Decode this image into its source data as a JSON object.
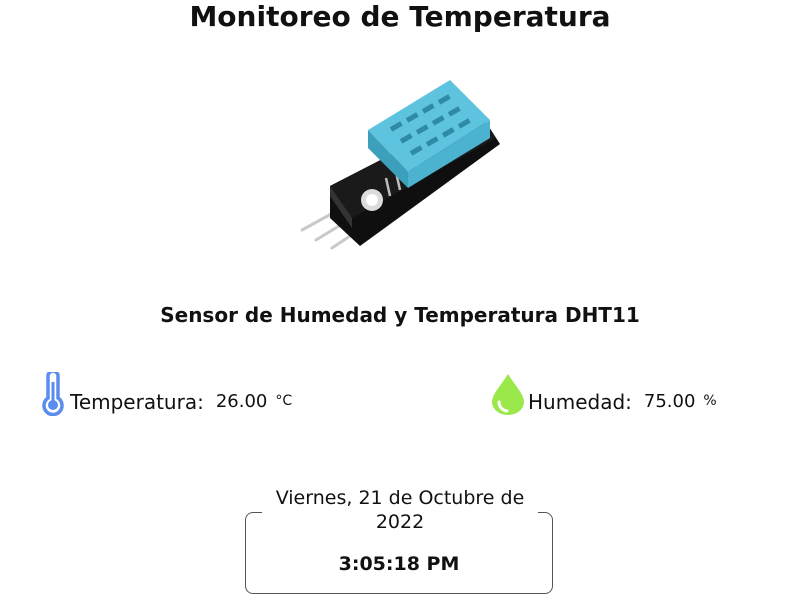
{
  "header": {
    "title": "Monitoreo de Temperatura"
  },
  "sensor": {
    "image_icon": "dht11-sensor-module",
    "name": "Sensor de Humedad y Temperatura DHT11"
  },
  "readings": {
    "temperature": {
      "icon": "thermometer-icon",
      "icon_color": "#5b8def",
      "label": "Temperatura:",
      "value": "26.00",
      "unit": "°C"
    },
    "humidity": {
      "icon": "water-drop-icon",
      "icon_color": "#9be84a",
      "label": "Humedad:",
      "value": "75.00",
      "unit": "%"
    }
  },
  "datetime": {
    "date": "Viernes, 21 de Octubre de 2022",
    "time": "3:05:18 PM"
  },
  "colors": {
    "sensor_body": "#5ec3df",
    "board": "#1a1a1a"
  }
}
